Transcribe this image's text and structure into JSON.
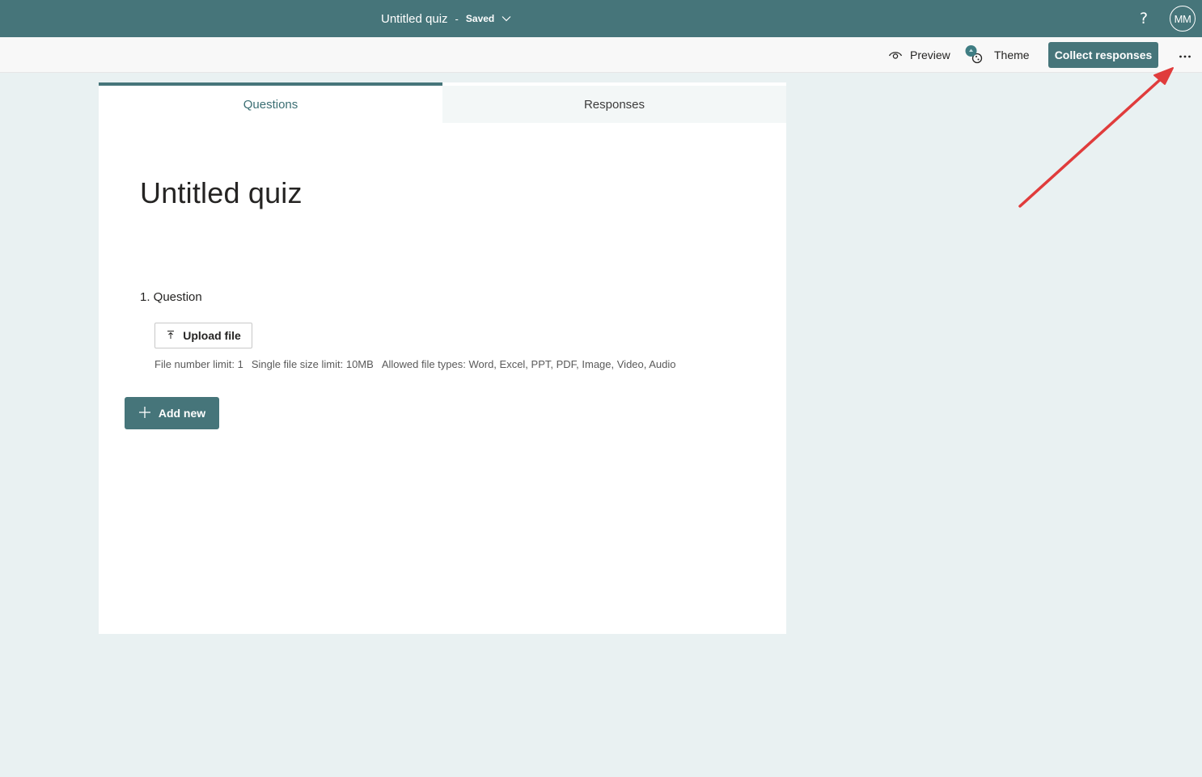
{
  "topbar": {
    "title": "Untitled quiz",
    "separator": "-",
    "status": "Saved",
    "help_icon": "?",
    "avatar_initials": "MM"
  },
  "commandbar": {
    "preview_label": "Preview",
    "theme_label": "Theme",
    "collect_label": "Collect responses",
    "more_icon": "ellipsis-icon"
  },
  "tabs": [
    {
      "label": "Questions",
      "active": true
    },
    {
      "label": "Responses",
      "active": false
    }
  ],
  "form": {
    "title": "Untitled quiz",
    "question": {
      "label": "1. Question",
      "upload_label": "Upload file",
      "limits": [
        "File number limit: 1",
        "Single file size limit: 10MB",
        "Allowed file types: Word, Excel, PPT, PDF, Image, Video, Audio"
      ]
    },
    "add_new_label": "Add new"
  },
  "colors": {
    "brand": "#46757a",
    "background": "#e9f1f2",
    "annotation_arrow": "#e03c3c"
  }
}
